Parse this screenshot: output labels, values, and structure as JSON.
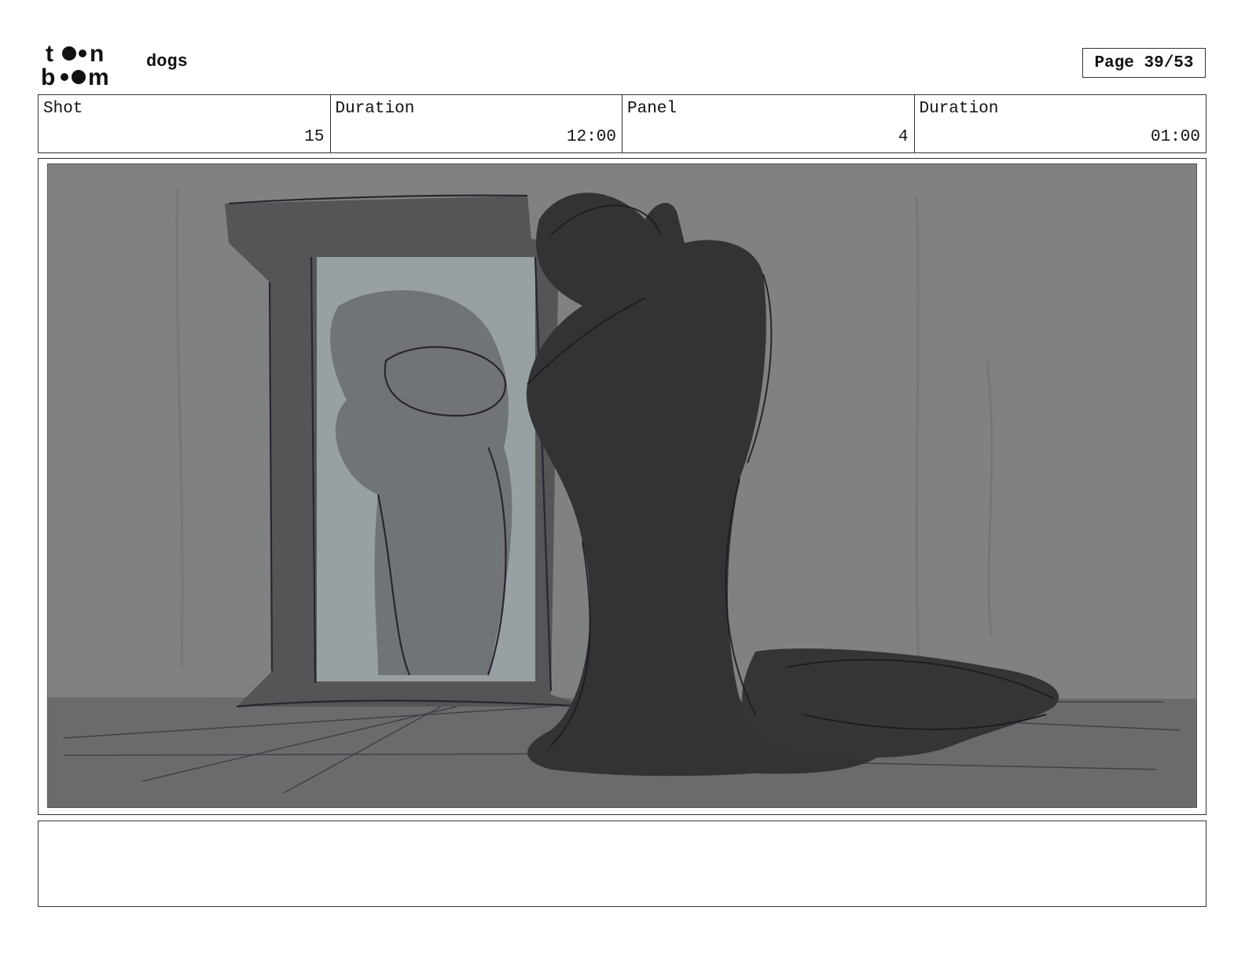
{
  "header": {
    "logo_icon": "toon-boom-logo-icon",
    "project_name": "dogs",
    "page_label": "Page 39/53"
  },
  "info": {
    "shot_label": "Shot",
    "shot_value": "15",
    "shot_duration_label": "Duration",
    "shot_duration_value": "12:00",
    "panel_label": "Panel",
    "panel_value": "4",
    "panel_duration_label": "Duration",
    "panel_duration_value": "01:00"
  },
  "notes": {
    "text": ""
  },
  "colors": {
    "wall": "#808282",
    "floor": "#6b6b6d",
    "mirror_frame": "#555557",
    "mirror_glass": "#98a0a4",
    "silhouette": "#333335",
    "reflection": "#717476"
  }
}
